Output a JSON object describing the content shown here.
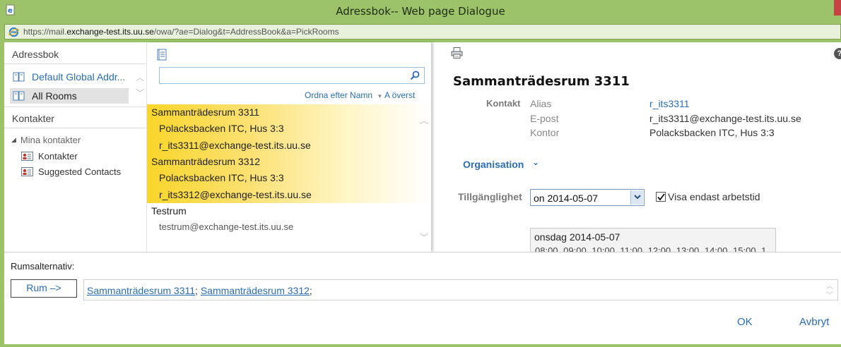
{
  "window": {
    "title": "Adressbok-- Web page Dialogue",
    "url_prefix": "https://mail.",
    "url_domain": "exchange-test.its.uu.se",
    "url_path": "/owa/?ae=Dialog&t=AddressBook&a=PickRooms"
  },
  "sidebar": {
    "address_books_heading": "Adressbok",
    "books": [
      {
        "label": "Default Global Addr...",
        "selected": false
      },
      {
        "label": "All Rooms",
        "selected": true
      }
    ],
    "contacts_heading": "Kontakter",
    "tree_root": "Mina kontakter",
    "contact_folders": [
      {
        "label": "Kontakter"
      },
      {
        "label": "Suggested Contacts"
      }
    ]
  },
  "list": {
    "search_placeholder": "",
    "sort_label": "Ordna efter Namn",
    "top_label": "A överst",
    "records": [
      {
        "name": "Sammanträdesrum 3311",
        "location": "Polacksbacken ITC, Hus 3:3",
        "email": "r_its3311@exchange-test.its.uu.se",
        "selected": true
      },
      {
        "name": "Sammanträdesrum 3312",
        "location": "Polacksbacken ITC, Hus 3:3",
        "email": "r_its3312@exchange-test.its.uu.se",
        "selected": true
      },
      {
        "name": "Testrum",
        "email": "testrum@exchange-test.its.uu.se",
        "selected": false
      }
    ]
  },
  "detail": {
    "title": "Sammanträdesrum 3311",
    "contact_section": "Kontakt",
    "props": [
      {
        "label": "Alias",
        "value": "r_its3311",
        "link": true
      },
      {
        "label": "E-post",
        "value": "r_its3311@exchange-test.its.uu.se",
        "link": false
      },
      {
        "label": "Kontor",
        "value": "Polacksbacken ITC, Hus 3:3",
        "link": false
      }
    ],
    "organisation_label": "Organisation",
    "availability_label": "Tillgänglighet",
    "date_select_value": "on 2014-05-07",
    "work_hours_label": "Visa endast arbetstid",
    "work_hours_checked": true,
    "calendar_date": "onsdag 2014-05-07",
    "calendar_hours": "08:00 09:00 10:00 11:00 12:00 13:00 14:00 15:00 1"
  },
  "bottom": {
    "rooms_caption": "Rumsalternativ:",
    "rooms_button": "Rum –>",
    "selected_rooms": [
      "Sammanträdesrum 3311",
      "Sammanträdesrum 3312"
    ],
    "ok_label": "OK",
    "cancel_label": "Avbryt"
  },
  "colors": {
    "accent_link": "#2a6db5",
    "title_bar": "#9cc36a",
    "selection_yellow": "#f9d62b"
  }
}
